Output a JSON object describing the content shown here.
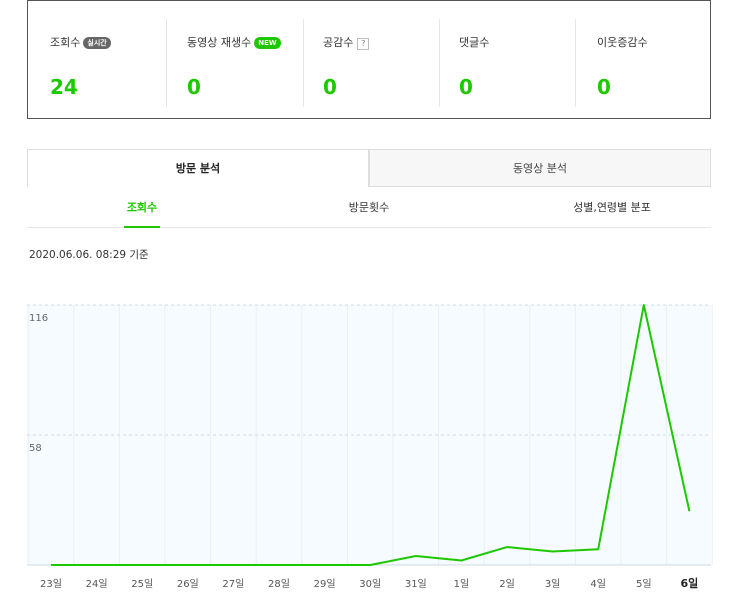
{
  "stats": [
    {
      "label": "조회수",
      "badge": "실시간",
      "badge_color": "gray",
      "value": "24"
    },
    {
      "label": "동영상 재생수",
      "badge": "NEW",
      "badge_color": "green",
      "value": "0"
    },
    {
      "label": "공감수",
      "help": "?",
      "value": "0"
    },
    {
      "label": "댓글수",
      "value": "0"
    },
    {
      "label": "이웃증감수",
      "value": "0"
    }
  ],
  "tabs": [
    {
      "label": "방문 분석",
      "active": true
    },
    {
      "label": "동영상 분석",
      "active": false
    }
  ],
  "subtabs": [
    {
      "label": "조회수",
      "active": true
    },
    {
      "label": "방문횟수",
      "active": false
    },
    {
      "label": "성별,연령별 분포",
      "active": false
    }
  ],
  "timestamp": "2020.06.06. 08:29 기준",
  "colors": {
    "accent": "#1ec800",
    "plot_bg": "#f5fbff",
    "border": "#555555"
  },
  "chart_data": {
    "type": "line",
    "categories": [
      "23일",
      "24일",
      "25일",
      "26일",
      "27일",
      "28일",
      "29일",
      "30일",
      "31일",
      "1일",
      "2일",
      "3일",
      "4일",
      "5일",
      "6일"
    ],
    "series": [
      {
        "values": [
          0,
          0,
          0,
          0,
          0,
          0,
          0,
          0,
          4,
          2,
          8,
          6,
          7,
          116,
          24
        ]
      }
    ],
    "yticks": [
      "58",
      "116"
    ],
    "ylim": [
      0,
      116
    ],
    "highlight_category": "6일",
    "grid": true
  }
}
